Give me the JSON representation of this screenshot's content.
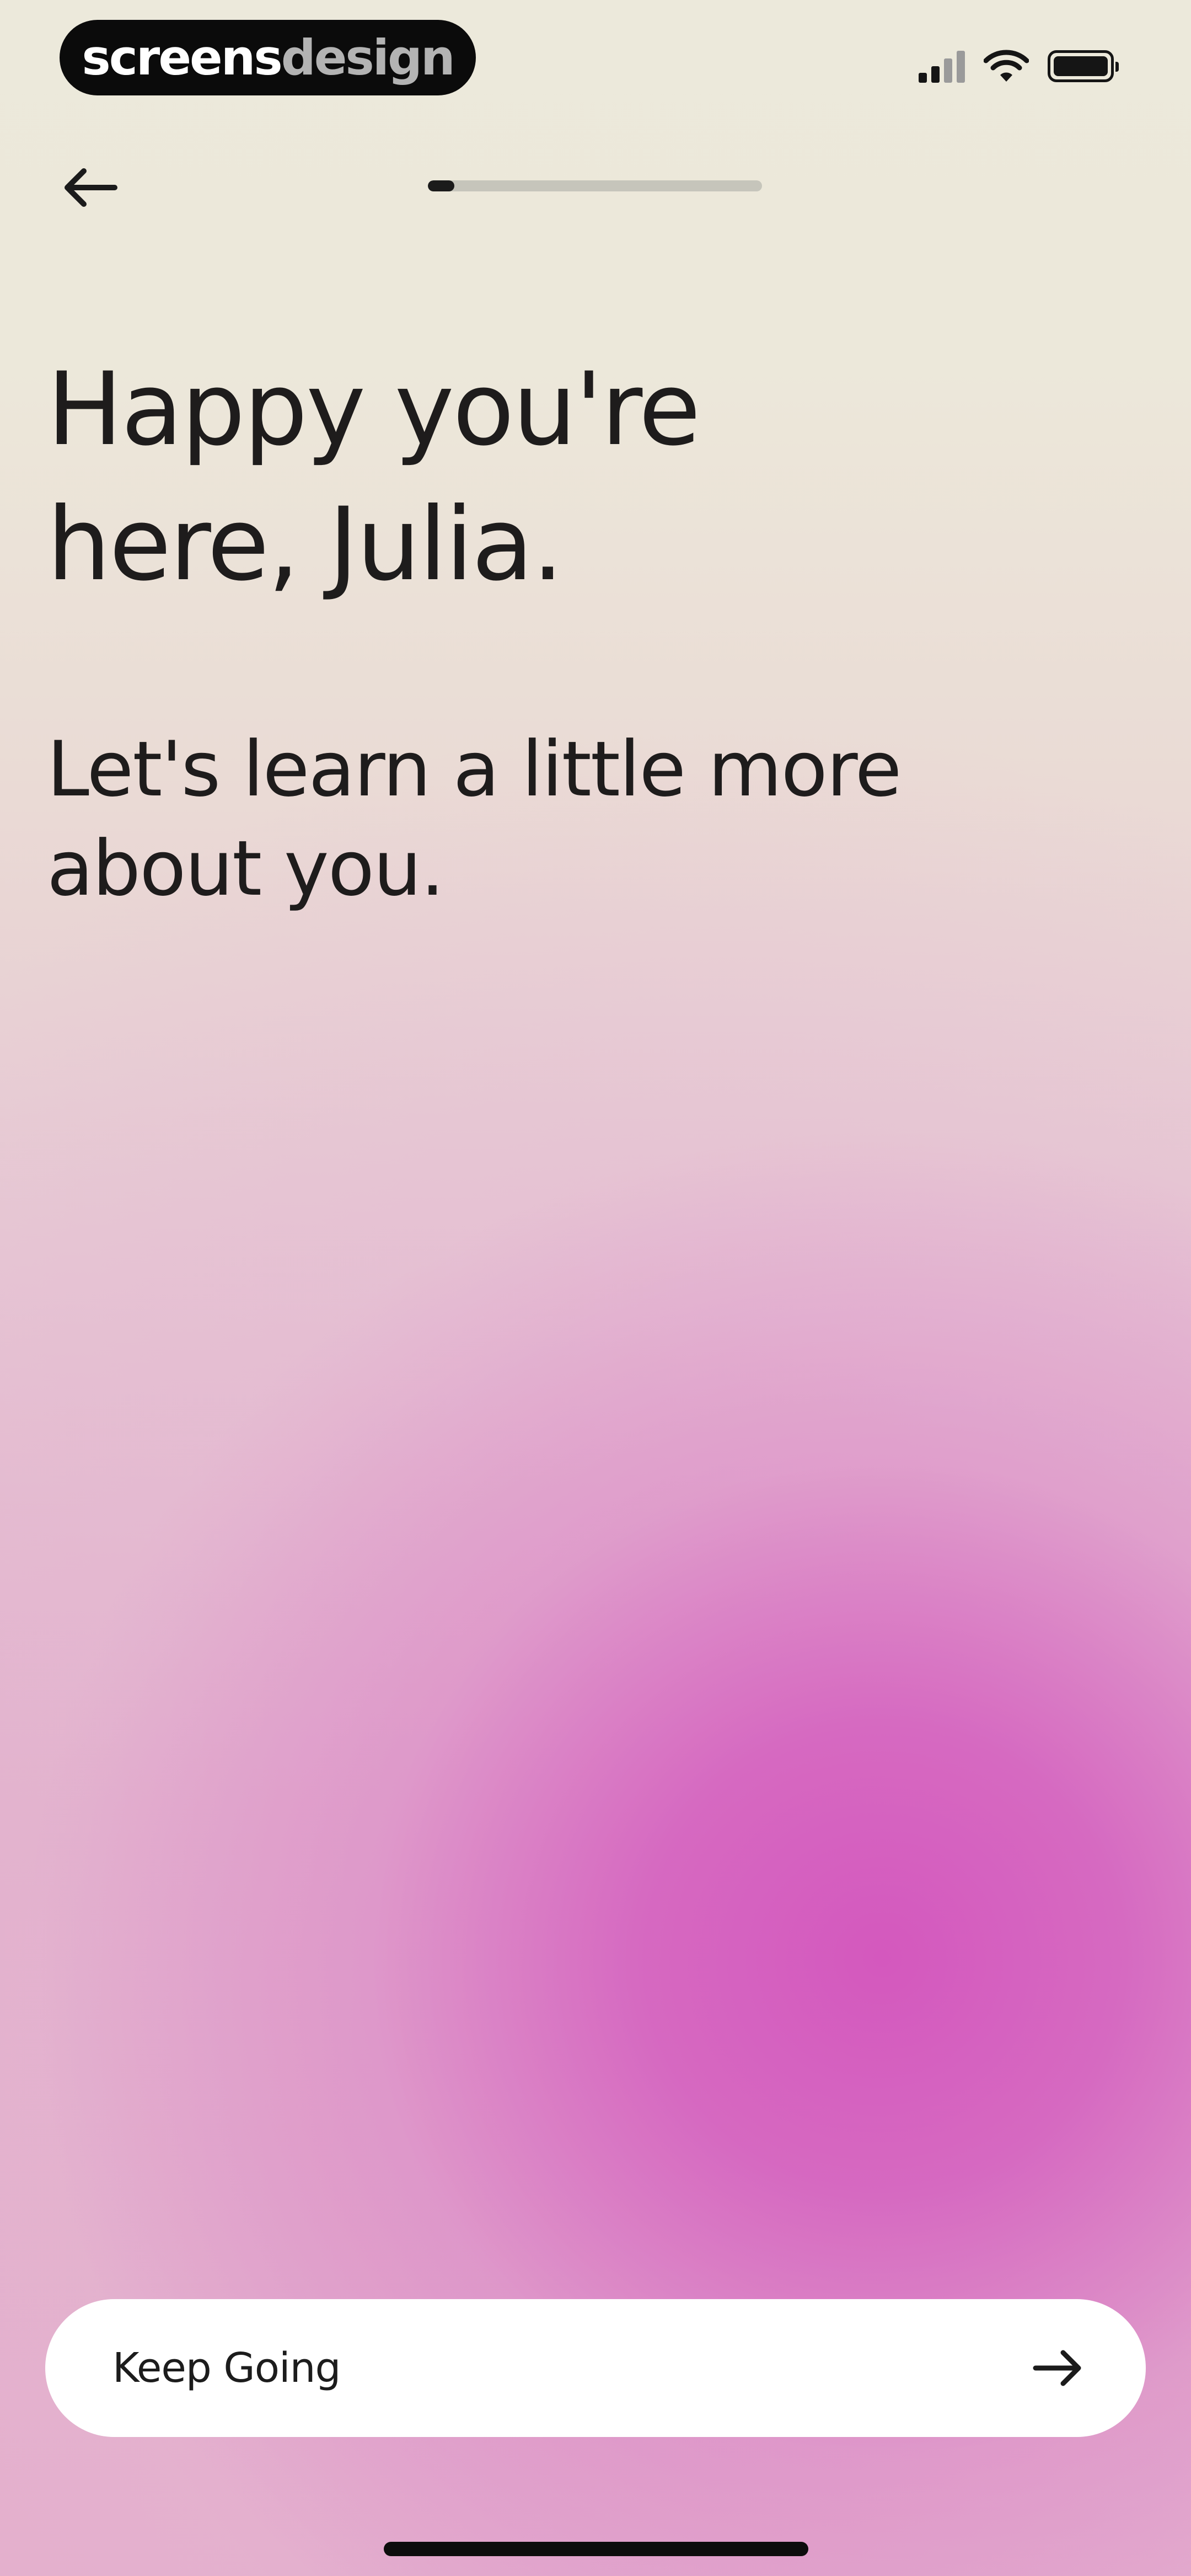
{
  "status_bar": {
    "brand_primary": "screens",
    "brand_secondary": "design",
    "icons": [
      "cellular-signal-icon",
      "wifi-icon",
      "battery-icon"
    ]
  },
  "nav": {
    "back_icon": "arrow-left-icon",
    "progress_fraction": 0.08
  },
  "content": {
    "heading_lines": [
      "Happy you're",
      "here, Julia."
    ],
    "subheading_lines": [
      "Let's learn a little more",
      "about you."
    ]
  },
  "cta": {
    "label": "Keep Going",
    "icon": "arrow-right-icon"
  },
  "colors": {
    "text": "#1e1c1c",
    "accent_gradient": "#d458be",
    "background_top": "#ece9db",
    "button_bg": "#ffffff"
  }
}
